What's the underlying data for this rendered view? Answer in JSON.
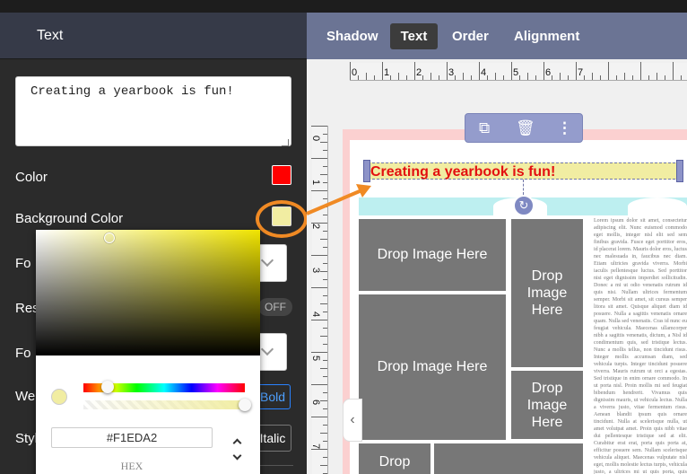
{
  "left_panel": {
    "title": "Text",
    "text_value": "Creating a yearbook is fun!",
    "color_label": "Color",
    "color_swatch": "#ff0000",
    "background_color_label": "Background Color",
    "background_swatch": "#F1EDA2",
    "font_label_partial": "Fo",
    "resize_label_partial": "Res",
    "font_size_label_partial": "Fo",
    "weight_label_partial": "Wei",
    "style_label_partial": "Styl",
    "toggle_label": "OFF",
    "bold_label": "Bold",
    "italic_label": "Italic"
  },
  "color_picker": {
    "hex_value": "#F1EDA2",
    "hex_label": "HEX",
    "hue_fraction": 0.15,
    "alpha_fraction": 1.0
  },
  "tabs": [
    {
      "label": "Shadow"
    },
    {
      "label": "Text"
    },
    {
      "label": "Order"
    },
    {
      "label": "Alignment"
    }
  ],
  "active_tab": "Text",
  "ruler": {
    "top": [
      "0",
      "1",
      "2",
      "3",
      "4",
      "5",
      "6",
      "7"
    ],
    "left": [
      "0",
      "1",
      "2",
      "3",
      "4",
      "5",
      "6",
      "7"
    ]
  },
  "canvas": {
    "text_element": "Creating a yearbook is fun!",
    "drop_wide": "Drop Image Here",
    "drop_narrow": "Drop Image Here",
    "drop_short": "Drop",
    "lorem": "Lorem ipsum dolor sit amet, consectetur adipiscing elit. Nunc euismod commodo eget mollis, integer nisl elit sed sem finibus gravida. Fusce eget porttitor eros, id placerat lorem. Mauris dolor eros, luctus nec malesuada in, faucibus nec diam. Etiam ultricies gravida viverra. Morbi iaculis pellentesque luctus. Sed porttitor nisi eget dignissim imperdiet sollicitudin. Donec a mi ut odio venenatis rutrum id quis nisi. Nullam ultrices fermentum semper. Morbi sit amet, sit cursus semper litora sit amet. Quisque aliquet diam id posuere. Nulla a sagittis venenatis ornare quam. Nulla sed venenatis. Cras id nunc eu feugiat vehicula. Maecenas ullamcorper nibh a sagittis venenatis, dictum, a Nisl id condimentum quis, sed tristique lectus. Nunc a mollis tellus, non tincidunt risus. Integer mollis accumsan diam, sed vehicula turpis. Integer tincidunt posuere viverra. Mauris rutrum ut orci a egestas. Sed tristique in enim ornare commodo. In ut porta nisl. Proin mollis mi sed feugiat bibendum hendrerit. Vivamus quis dignissim mauris, ut vehicula lectus. Nulla a viverra justo, vitae fermentum risus. Aenean blandit ipsum quis ornare tincidunt. Nulla at scelerisque nulla, ut amet volutpat amet. Proin quis nibh vitae dui pellentesque tristique sed at elit. Curabitur erat erat, porta quis porta at, efficitur posuere sem. Nullam scelerisque vehicula aliquet. Maecenas vulputate nisl eget, mollis molestie lectus turpis, vehicula justo, a ultrices mi ut quis porta, quis gravida mi in felis. Donec vulputate, elit eget dictum ut eros. Nunc at ipsum mi, eget ultrices."
  }
}
